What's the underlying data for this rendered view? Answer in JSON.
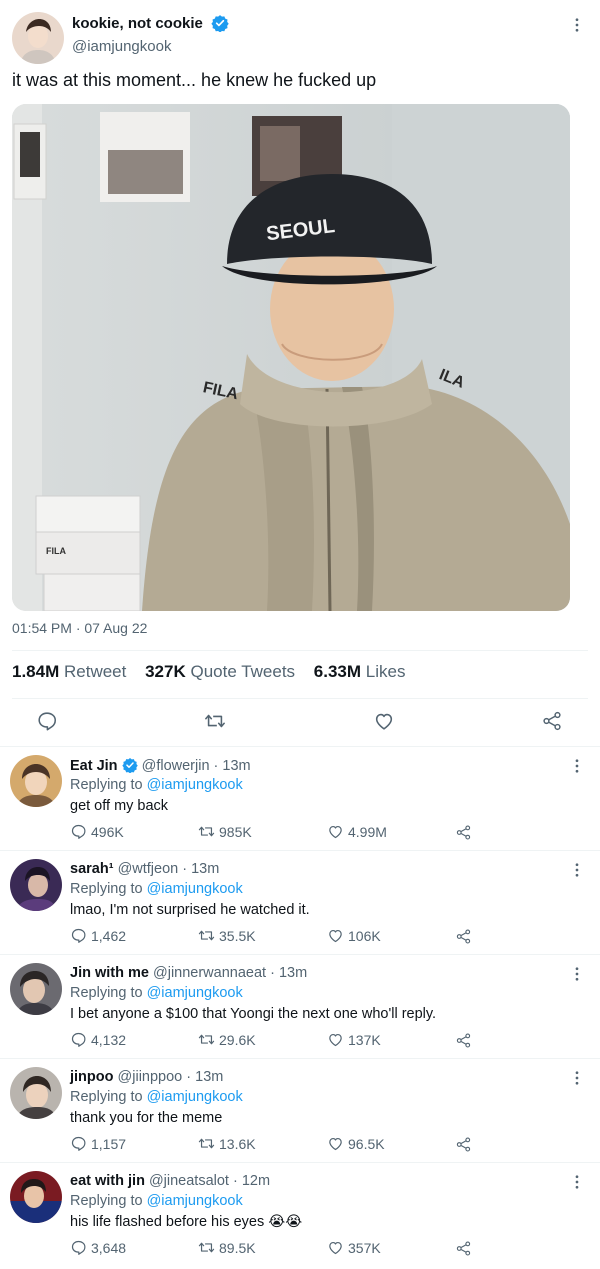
{
  "tweet": {
    "display_name": "kookie, not cookie",
    "handle": "@iamjungkook",
    "text": "it was at this moment... he knew he fucked up",
    "time": "01:54 PM · 07 Aug 22",
    "stats": {
      "retweets_count": "1.84M",
      "retweets_label": "Retweet",
      "quotes_count": "327K",
      "quotes_label": "Quote Tweets",
      "likes_count": "6.33M",
      "likes_label": "Likes"
    },
    "photo": {
      "cap_text": "SEOUL",
      "jacket_text_left": "FILA",
      "jacket_text_right": "ILA",
      "box_brand": "FILA"
    }
  },
  "icons": {
    "verified": "verified-badge-icon",
    "more": "more-vertical-icon",
    "reply": "reply-bubble-icon",
    "retweet": "retweet-icon",
    "like": "heart-icon",
    "share": "share-icon"
  },
  "colors": {
    "accent": "#1d9bf0",
    "muted": "#536471",
    "divider": "#eff3f4"
  },
  "replies": [
    {
      "name": "Eat Jin",
      "verified": true,
      "handle": "@flowerjin",
      "time": "· 13m",
      "replying_label": "Replying to",
      "replying_to": "@iamjungkook",
      "text": "get off my back",
      "replies": "496K",
      "retweets": "985K",
      "likes": "4.99M"
    },
    {
      "name": "sarah¹",
      "verified": false,
      "handle": "@wtfjeon",
      "time": "· 13m",
      "replying_label": "Replying to",
      "replying_to": "@iamjungkook",
      "text": "lmao, I'm not surprised he watched it.",
      "replies": "1,462",
      "retweets": "35.5K",
      "likes": "106K"
    },
    {
      "name": "Jin with me",
      "verified": false,
      "handle": "@jinnerwannaeat",
      "time": "· 13m",
      "replying_label": "Replying to",
      "replying_to": "@iamjungkook",
      "text": "I bet anyone a $100 that Yoongi the next one who'll reply.",
      "replies": "4,132",
      "retweets": "29.6K",
      "likes": "137K"
    },
    {
      "name": "jinpoo",
      "verified": false,
      "handle": "@jiinppoo",
      "time": "· 13m",
      "replying_label": "Replying to",
      "replying_to": "@iamjungkook",
      "text": "thank you for the meme",
      "replies": "1,157",
      "retweets": "13.6K",
      "likes": "96.5K"
    },
    {
      "name": "eat with jin",
      "verified": false,
      "handle": "@jineatsalot",
      "time": "· 12m",
      "replying_label": "Replying to",
      "replying_to": "@iamjungkook",
      "text": "his life flashed before his eyes 😭😭",
      "replies": "3,648",
      "retweets": "89.5K",
      "likes": "357K"
    }
  ]
}
